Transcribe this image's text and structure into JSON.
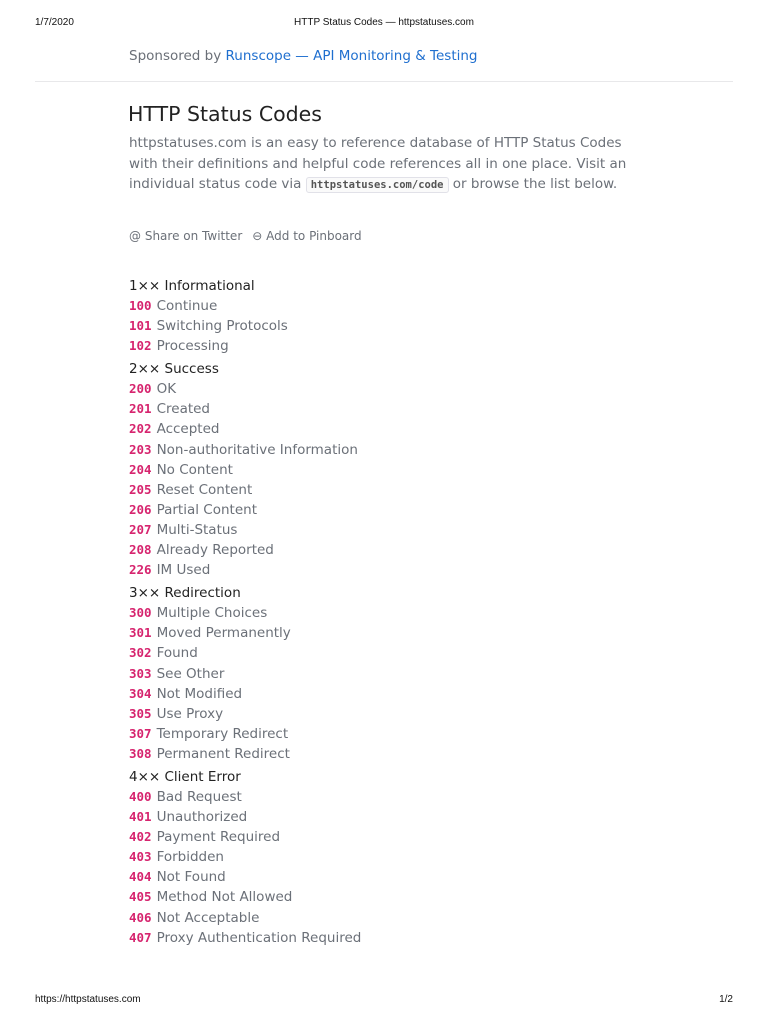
{
  "print_header": {
    "date": "1/7/2020",
    "title": "HTTP Status Codes — httpstatuses.com"
  },
  "print_footer": {
    "url": "https://httpstatuses.com",
    "page": "1/2"
  },
  "sponsor": {
    "prefix": "Sponsored by",
    "link_label": "Runscope — API Monitoring & Testing",
    "link_color": "#1f6fcf"
  },
  "page": {
    "title": "HTTP Status Codes",
    "intro_before": "httpstatuses.com is an easy to reference database of HTTP Status Codes with their definitions and helpful code references all in one place. Visit an individual status code via ",
    "intro_code": "httpstatuses.com/code",
    "intro_after": " or browse the list below."
  },
  "share": {
    "twitter": {
      "icon": "at-icon",
      "glyph": "@",
      "label": "Share on Twitter"
    },
    "pinboard": {
      "icon": "pinboard-icon",
      "glyph": "⊖",
      "label": "Add to Pinboard"
    }
  },
  "code_color": "#d6246e",
  "groups": [
    {
      "title": "1×× Informational",
      "items": [
        {
          "code": "100",
          "label": "Continue"
        },
        {
          "code": "101",
          "label": "Switching Protocols"
        },
        {
          "code": "102",
          "label": "Processing"
        }
      ]
    },
    {
      "title": "2×× Success",
      "items": [
        {
          "code": "200",
          "label": "OK"
        },
        {
          "code": "201",
          "label": "Created"
        },
        {
          "code": "202",
          "label": "Accepted"
        },
        {
          "code": "203",
          "label": "Non-authoritative Information"
        },
        {
          "code": "204",
          "label": "No Content"
        },
        {
          "code": "205",
          "label": "Reset Content"
        },
        {
          "code": "206",
          "label": "Partial Content"
        },
        {
          "code": "207",
          "label": "Multi-Status"
        },
        {
          "code": "208",
          "label": "Already Reported"
        },
        {
          "code": "226",
          "label": "IM Used"
        }
      ]
    },
    {
      "title": "3×× Redirection",
      "items": [
        {
          "code": "300",
          "label": "Multiple Choices"
        },
        {
          "code": "301",
          "label": "Moved Permanently"
        },
        {
          "code": "302",
          "label": "Found"
        },
        {
          "code": "303",
          "label": "See Other"
        },
        {
          "code": "304",
          "label": "Not Modified"
        },
        {
          "code": "305",
          "label": "Use Proxy"
        },
        {
          "code": "307",
          "label": "Temporary Redirect"
        },
        {
          "code": "308",
          "label": "Permanent Redirect"
        }
      ]
    },
    {
      "title": "4×× Client Error",
      "items": [
        {
          "code": "400",
          "label": "Bad Request"
        },
        {
          "code": "401",
          "label": "Unauthorized"
        },
        {
          "code": "402",
          "label": "Payment Required"
        },
        {
          "code": "403",
          "label": "Forbidden"
        },
        {
          "code": "404",
          "label": "Not Found"
        },
        {
          "code": "405",
          "label": "Method Not Allowed"
        },
        {
          "code": "406",
          "label": "Not Acceptable"
        },
        {
          "code": "407",
          "label": "Proxy Authentication Required"
        }
      ]
    }
  ]
}
